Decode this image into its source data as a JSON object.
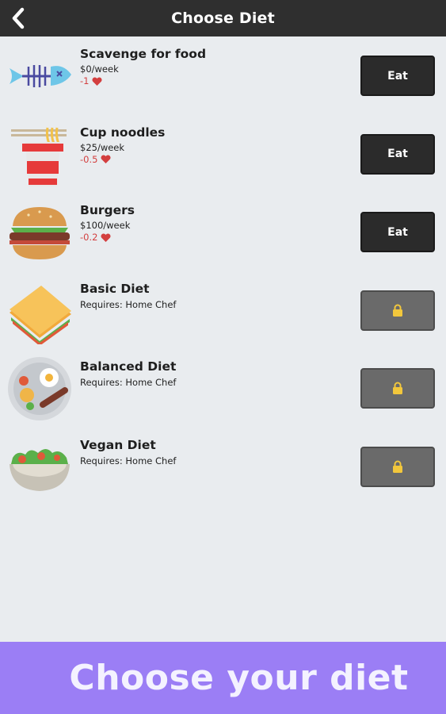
{
  "header": {
    "title": "Choose Diet",
    "back_icon": "chevron-left-icon"
  },
  "diets": [
    {
      "name": "Scavenge for food",
      "price": "$0/week",
      "health": "-1",
      "requires": "",
      "state": "available",
      "button_label": "Eat",
      "icon": "fish-bone-icon"
    },
    {
      "name": "Cup noodles",
      "price": "$25/week",
      "health": "-0.5",
      "requires": "",
      "state": "available",
      "button_label": "Eat",
      "icon": "cup-noodles-icon"
    },
    {
      "name": "Burgers",
      "price": "$100/week",
      "health": "-0.2",
      "requires": "",
      "state": "available",
      "button_label": "Eat",
      "icon": "burger-icon"
    },
    {
      "name": "Basic Diet",
      "price": "",
      "health": "",
      "requires": "Requires: Home Chef",
      "state": "locked",
      "button_label": "",
      "icon": "sandwich-icon"
    },
    {
      "name": "Balanced Diet",
      "price": "",
      "health": "",
      "requires": "Requires: Home Chef",
      "state": "locked",
      "button_label": "",
      "icon": "balanced-plate-icon"
    },
    {
      "name": "Vegan Diet",
      "price": "",
      "health": "",
      "requires": "Requires: Home Chef",
      "state": "locked",
      "button_label": "",
      "icon": "salad-bowl-icon"
    }
  ],
  "banner": {
    "text": "Choose your diet"
  },
  "colors": {
    "header_bg": "#2f2f2f",
    "page_bg": "#e9ecef",
    "eat_button_bg": "#2b2b2b",
    "locked_button_bg": "#6a6a6a",
    "health_red": "#d33f3f",
    "banner_bg": "#9b7ef5"
  }
}
